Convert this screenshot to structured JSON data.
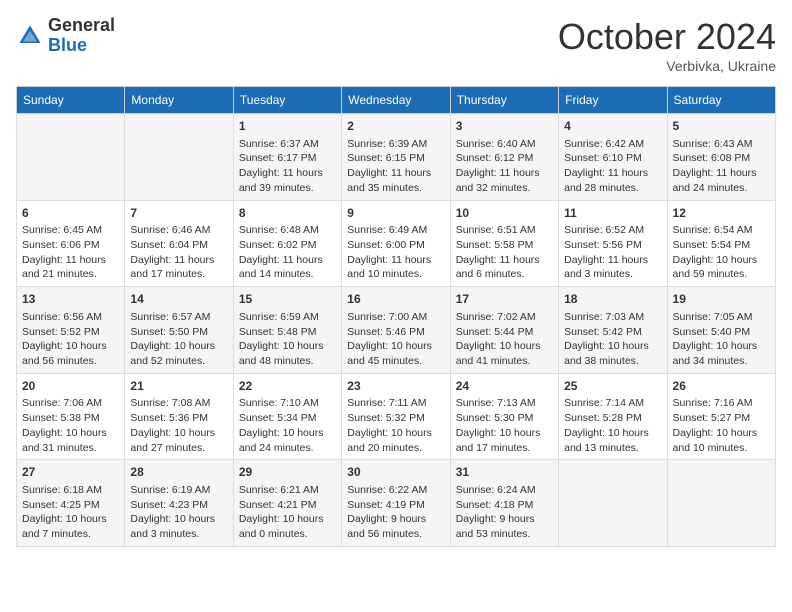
{
  "header": {
    "logo_general": "General",
    "logo_blue": "Blue",
    "month_title": "October 2024",
    "subtitle": "Verbivka, Ukraine"
  },
  "weekdays": [
    "Sunday",
    "Monday",
    "Tuesday",
    "Wednesday",
    "Thursday",
    "Friday",
    "Saturday"
  ],
  "weeks": [
    [
      {
        "day": "",
        "info": ""
      },
      {
        "day": "",
        "info": ""
      },
      {
        "day": "1",
        "info": "Sunrise: 6:37 AM\nSunset: 6:17 PM\nDaylight: 11 hours and 39 minutes."
      },
      {
        "day": "2",
        "info": "Sunrise: 6:39 AM\nSunset: 6:15 PM\nDaylight: 11 hours and 35 minutes."
      },
      {
        "day": "3",
        "info": "Sunrise: 6:40 AM\nSunset: 6:12 PM\nDaylight: 11 hours and 32 minutes."
      },
      {
        "day": "4",
        "info": "Sunrise: 6:42 AM\nSunset: 6:10 PM\nDaylight: 11 hours and 28 minutes."
      },
      {
        "day": "5",
        "info": "Sunrise: 6:43 AM\nSunset: 6:08 PM\nDaylight: 11 hours and 24 minutes."
      }
    ],
    [
      {
        "day": "6",
        "info": "Sunrise: 6:45 AM\nSunset: 6:06 PM\nDaylight: 11 hours and 21 minutes."
      },
      {
        "day": "7",
        "info": "Sunrise: 6:46 AM\nSunset: 6:04 PM\nDaylight: 11 hours and 17 minutes."
      },
      {
        "day": "8",
        "info": "Sunrise: 6:48 AM\nSunset: 6:02 PM\nDaylight: 11 hours and 14 minutes."
      },
      {
        "day": "9",
        "info": "Sunrise: 6:49 AM\nSunset: 6:00 PM\nDaylight: 11 hours and 10 minutes."
      },
      {
        "day": "10",
        "info": "Sunrise: 6:51 AM\nSunset: 5:58 PM\nDaylight: 11 hours and 6 minutes."
      },
      {
        "day": "11",
        "info": "Sunrise: 6:52 AM\nSunset: 5:56 PM\nDaylight: 11 hours and 3 minutes."
      },
      {
        "day": "12",
        "info": "Sunrise: 6:54 AM\nSunset: 5:54 PM\nDaylight: 10 hours and 59 minutes."
      }
    ],
    [
      {
        "day": "13",
        "info": "Sunrise: 6:56 AM\nSunset: 5:52 PM\nDaylight: 10 hours and 56 minutes."
      },
      {
        "day": "14",
        "info": "Sunrise: 6:57 AM\nSunset: 5:50 PM\nDaylight: 10 hours and 52 minutes."
      },
      {
        "day": "15",
        "info": "Sunrise: 6:59 AM\nSunset: 5:48 PM\nDaylight: 10 hours and 48 minutes."
      },
      {
        "day": "16",
        "info": "Sunrise: 7:00 AM\nSunset: 5:46 PM\nDaylight: 10 hours and 45 minutes."
      },
      {
        "day": "17",
        "info": "Sunrise: 7:02 AM\nSunset: 5:44 PM\nDaylight: 10 hours and 41 minutes."
      },
      {
        "day": "18",
        "info": "Sunrise: 7:03 AM\nSunset: 5:42 PM\nDaylight: 10 hours and 38 minutes."
      },
      {
        "day": "19",
        "info": "Sunrise: 7:05 AM\nSunset: 5:40 PM\nDaylight: 10 hours and 34 minutes."
      }
    ],
    [
      {
        "day": "20",
        "info": "Sunrise: 7:06 AM\nSunset: 5:38 PM\nDaylight: 10 hours and 31 minutes."
      },
      {
        "day": "21",
        "info": "Sunrise: 7:08 AM\nSunset: 5:36 PM\nDaylight: 10 hours and 27 minutes."
      },
      {
        "day": "22",
        "info": "Sunrise: 7:10 AM\nSunset: 5:34 PM\nDaylight: 10 hours and 24 minutes."
      },
      {
        "day": "23",
        "info": "Sunrise: 7:11 AM\nSunset: 5:32 PM\nDaylight: 10 hours and 20 minutes."
      },
      {
        "day": "24",
        "info": "Sunrise: 7:13 AM\nSunset: 5:30 PM\nDaylight: 10 hours and 17 minutes."
      },
      {
        "day": "25",
        "info": "Sunrise: 7:14 AM\nSunset: 5:28 PM\nDaylight: 10 hours and 13 minutes."
      },
      {
        "day": "26",
        "info": "Sunrise: 7:16 AM\nSunset: 5:27 PM\nDaylight: 10 hours and 10 minutes."
      }
    ],
    [
      {
        "day": "27",
        "info": "Sunrise: 6:18 AM\nSunset: 4:25 PM\nDaylight: 10 hours and 7 minutes."
      },
      {
        "day": "28",
        "info": "Sunrise: 6:19 AM\nSunset: 4:23 PM\nDaylight: 10 hours and 3 minutes."
      },
      {
        "day": "29",
        "info": "Sunrise: 6:21 AM\nSunset: 4:21 PM\nDaylight: 10 hours and 0 minutes."
      },
      {
        "day": "30",
        "info": "Sunrise: 6:22 AM\nSunset: 4:19 PM\nDaylight: 9 hours and 56 minutes."
      },
      {
        "day": "31",
        "info": "Sunrise: 6:24 AM\nSunset: 4:18 PM\nDaylight: 9 hours and 53 minutes."
      },
      {
        "day": "",
        "info": ""
      },
      {
        "day": "",
        "info": ""
      }
    ]
  ]
}
